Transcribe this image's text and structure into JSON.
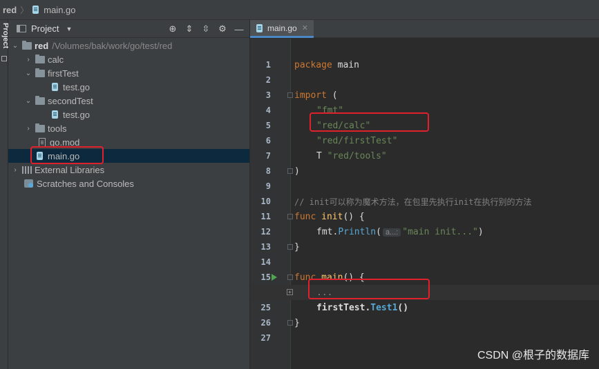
{
  "breadcrumb": {
    "project": "red",
    "file": "main.go"
  },
  "project_panel": {
    "title": "Project",
    "tree": [
      {
        "name": "red",
        "path": "/Volumes/bak/work/go/test/red",
        "type": "folder",
        "expanded": true,
        "depth": 0
      },
      {
        "name": "calc",
        "type": "folder",
        "expanded": false,
        "depth": 1
      },
      {
        "name": "firstTest",
        "type": "folder",
        "expanded": true,
        "depth": 1
      },
      {
        "name": "test.go",
        "type": "go",
        "depth": 2
      },
      {
        "name": "secondTest",
        "type": "folder",
        "expanded": true,
        "depth": 1
      },
      {
        "name": "test.go",
        "type": "go",
        "depth": 2
      },
      {
        "name": "tools",
        "type": "folder",
        "expanded": false,
        "depth": 1
      },
      {
        "name": "go.mod",
        "type": "mod",
        "depth": 1
      },
      {
        "name": "main.go",
        "type": "go",
        "depth": 1,
        "selected": true
      },
      {
        "name": "External Libraries",
        "type": "lib",
        "depth": 0
      },
      {
        "name": "Scratches and Consoles",
        "type": "scratch",
        "depth": 0
      }
    ]
  },
  "editor": {
    "tab": "main.go",
    "lines": [
      {
        "num": "1"
      },
      {
        "num": "2"
      },
      {
        "num": "3"
      },
      {
        "num": "4"
      },
      {
        "num": "5"
      },
      {
        "num": "6"
      },
      {
        "num": "7"
      },
      {
        "num": "8"
      },
      {
        "num": "9"
      },
      {
        "num": "10"
      },
      {
        "num": "11"
      },
      {
        "num": "12"
      },
      {
        "num": "13"
      },
      {
        "num": "14"
      },
      {
        "num": "15"
      },
      {
        "num": ""
      },
      {
        "num": "25"
      },
      {
        "num": "26"
      },
      {
        "num": "27"
      }
    ],
    "code": {
      "l1_kw": "package",
      "l1_rest": " main",
      "l3_kw": "import",
      "l3_rest": " (",
      "l4": "\"fmt\"",
      "l5": "\"red/calc\"",
      "l6": "\"red/firstTest\"",
      "l7_prefix": "T ",
      "l7": "\"red/tools\"",
      "l8": ")",
      "l10": "// init可以称为魔术方法，在包里先执行init在执行别的方法",
      "l11_kw": "func",
      "l11_fn": " init",
      "l11_rest": "() {",
      "l12_obj": "fmt.",
      "l12_call": "Println",
      "l12_open": "(",
      "l12_hint": "a...:",
      "l12_str": "\"main init...\"",
      "l12_close": ")",
      "l13": "}",
      "l15_kw": "func",
      "l15_fn": " main",
      "l15_rest": "() {",
      "l16": "...",
      "l25_obj": "firstTest.",
      "l25_call": "Test1",
      "l25_rest": "()",
      "l26": "}"
    }
  },
  "watermark": "CSDN @根子的数据库"
}
